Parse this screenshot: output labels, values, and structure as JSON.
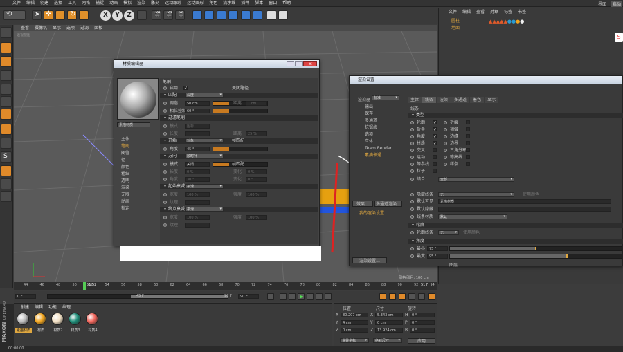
{
  "menubar": {
    "items": [
      "文件",
      "编辑",
      "创建",
      "选择",
      "工具",
      "网格",
      "捕捉",
      "动画",
      "模拟",
      "渲染",
      "雕刻",
      "运动跟踪",
      "运动图形",
      "角色",
      "流水线",
      "插件",
      "脚本",
      "窗口",
      "帮助"
    ],
    "right_label": "界面",
    "right_btn": "启动"
  },
  "viewport": {
    "menu": [
      "查看",
      "摄像机",
      "显示",
      "选项",
      "过滤",
      "面板"
    ],
    "label": "透视视图",
    "grid_info": "网格间距 : 100 cm"
  },
  "obj_manager": {
    "menu": [
      "文件",
      "编辑",
      "查看",
      "对象",
      "标签",
      "书签"
    ],
    "objects": [
      "圆柱",
      "地面"
    ]
  },
  "mat_editor": {
    "title": "材质编辑器",
    "material_name": "素描材质",
    "channels": [
      "主体",
      "笔刷",
      "阀值",
      "径",
      "颜色",
      "粗细",
      "透明",
      "渲染",
      "无限",
      "动画",
      "指定"
    ],
    "header": "笔刷",
    "rows": [
      {
        "label": "启用",
        "check": "✓",
        "extra": "关闭路径"
      },
      {
        "section": "匹配",
        "value": "深度"
      },
      {
        "label": "调谐",
        "value": "50 cm",
        "dim_label": "距离",
        "dim_value": "1 cm"
      },
      {
        "label": "相位控制",
        "value": "60 °"
      },
      {
        "section": "过滤笔刷"
      },
      {
        "label": "模式",
        "value": "图标",
        "dim": true
      },
      {
        "label": "长度",
        "value": "",
        "dim": true,
        "dim_label": "距离",
        "dim_value": "25 %"
      },
      {
        "section": "开始",
        "value": "对象",
        "extra": "帧匹配"
      },
      {
        "label": "角度",
        "value": "45 °"
      },
      {
        "section": "方向",
        "value": "顺时针"
      },
      {
        "label": "模式",
        "value": "关闭",
        "extra": "帧匹配"
      },
      {
        "label": "长度",
        "value": "0 %",
        "dim": true,
        "dim_label": "变化",
        "dim_value": "0 %"
      },
      {
        "label": "角度",
        "value": "30 °",
        "dim": true,
        "dim_label": "变化",
        "dim_value": "0 °"
      },
      {
        "section": "起始衰减",
        "value": "平滑"
      },
      {
        "label": "宽度",
        "value": "100 %",
        "dim": true,
        "dim_label": "强度",
        "dim_value": "100 %"
      },
      {
        "label": "纹理",
        "value": "",
        "dim": true
      },
      {
        "section": "终点衰减",
        "value": "平滑"
      },
      {
        "label": "宽度",
        "value": "100 %",
        "dim": true,
        "dim_label": "强度",
        "dim_value": "100 %"
      },
      {
        "label": "纹理",
        "value": "",
        "dim": true
      }
    ]
  },
  "render_settings": {
    "title": "渲染设置",
    "renderer_label": "渲染器",
    "renderer": "标准",
    "left_items": [
      "输出",
      "保存",
      "多通道",
      "抗锯齿",
      "选项",
      "立体",
      "Team Render",
      "素描卡通"
    ],
    "effects_btn": "效果...",
    "multipass_btn": "多通道渲染...",
    "preset": "我的渲染设置",
    "render_btn": "渲染设置...",
    "tabs": [
      "主体",
      "线条",
      "渲染",
      "多通道",
      "着色",
      "显示"
    ],
    "active_tab": "线条",
    "section1": "线条",
    "section_type": "类型",
    "types_left": [
      "轮廓",
      "折叠",
      "角度",
      "材质",
      "交叉",
      "运动",
      "等参线",
      "粒子"
    ],
    "types_right": [
      "折痕",
      "褶皱",
      "边缘",
      "边界",
      "三角分布",
      "等高线",
      "样条"
    ],
    "checked_left": [
      true,
      true,
      true,
      true,
      false,
      false,
      false,
      false
    ],
    "mode_label": "结合",
    "mode_value": "全部",
    "hidden_label": "隐藏线条",
    "hidden_value": "无",
    "hidden_extra": "使用颜色",
    "default_vis_label": "默认可见",
    "default_vis_value": "素描材质",
    "default_hidden_label": "默认隐藏",
    "line_mat_label": "线条材质",
    "line_mat_value": "默认",
    "section_contour": "轮廓",
    "contour_label": "轮廓线条",
    "contour_value": "无",
    "contour_extra": "使用颜色",
    "section_angle": "角度",
    "min_label": "最小",
    "min_value": "75 °",
    "max_label": "最大",
    "max_value": "95 °",
    "bottom": "图层"
  },
  "timeline": {
    "ticks": [
      "44",
      "46",
      "48",
      "50",
      "52",
      "54",
      "56",
      "58",
      "60",
      "62",
      "64",
      "66",
      "68",
      "70",
      "72",
      "74",
      "76",
      "78",
      "80",
      "82",
      "84",
      "86",
      "88",
      "90",
      "92",
      "94"
    ],
    "current": "51",
    "current_label": "51 52",
    "end_label": "51 F",
    "start_frame": "0 F",
    "range_start": "45 F",
    "range_end": "90 F",
    "end_frame": "90 F"
  },
  "materials": {
    "menu": [
      "创建",
      "编辑",
      "功能",
      "纹理"
    ],
    "items": [
      {
        "name": "素描材质",
        "color": "#bdbdbd"
      },
      {
        "name": "材质",
        "color": "#f0a41e"
      },
      {
        "name": "材质2",
        "color": "#f2e0c4"
      },
      {
        "name": "材质3",
        "color": "#1c8c77"
      },
      {
        "name": "材质4",
        "color": "#f0645a"
      }
    ]
  },
  "coords": {
    "headers": [
      "位置",
      "尺寸",
      "旋转"
    ],
    "rows": [
      [
        "X",
        "80.207 cm",
        "X",
        "5.343 cm",
        "H",
        "0 °"
      ],
      [
        "Y",
        "4 cm",
        "Y",
        "0 cm",
        "P",
        "0 °"
      ],
      [
        "Z",
        "0 cm",
        "Z",
        "13.924 cm",
        "B",
        "0 °"
      ]
    ],
    "mode": "世界坐标",
    "size_mode": "绝对尺寸",
    "apply": "应用"
  },
  "statusbar": {
    "time": "00:00:00"
  },
  "brand": {
    "line1": "MAXON",
    "line2": "CINEMA 4D"
  },
  "colors": {
    "accent": "#e08a2a",
    "blue": "#3a7ad0"
  }
}
